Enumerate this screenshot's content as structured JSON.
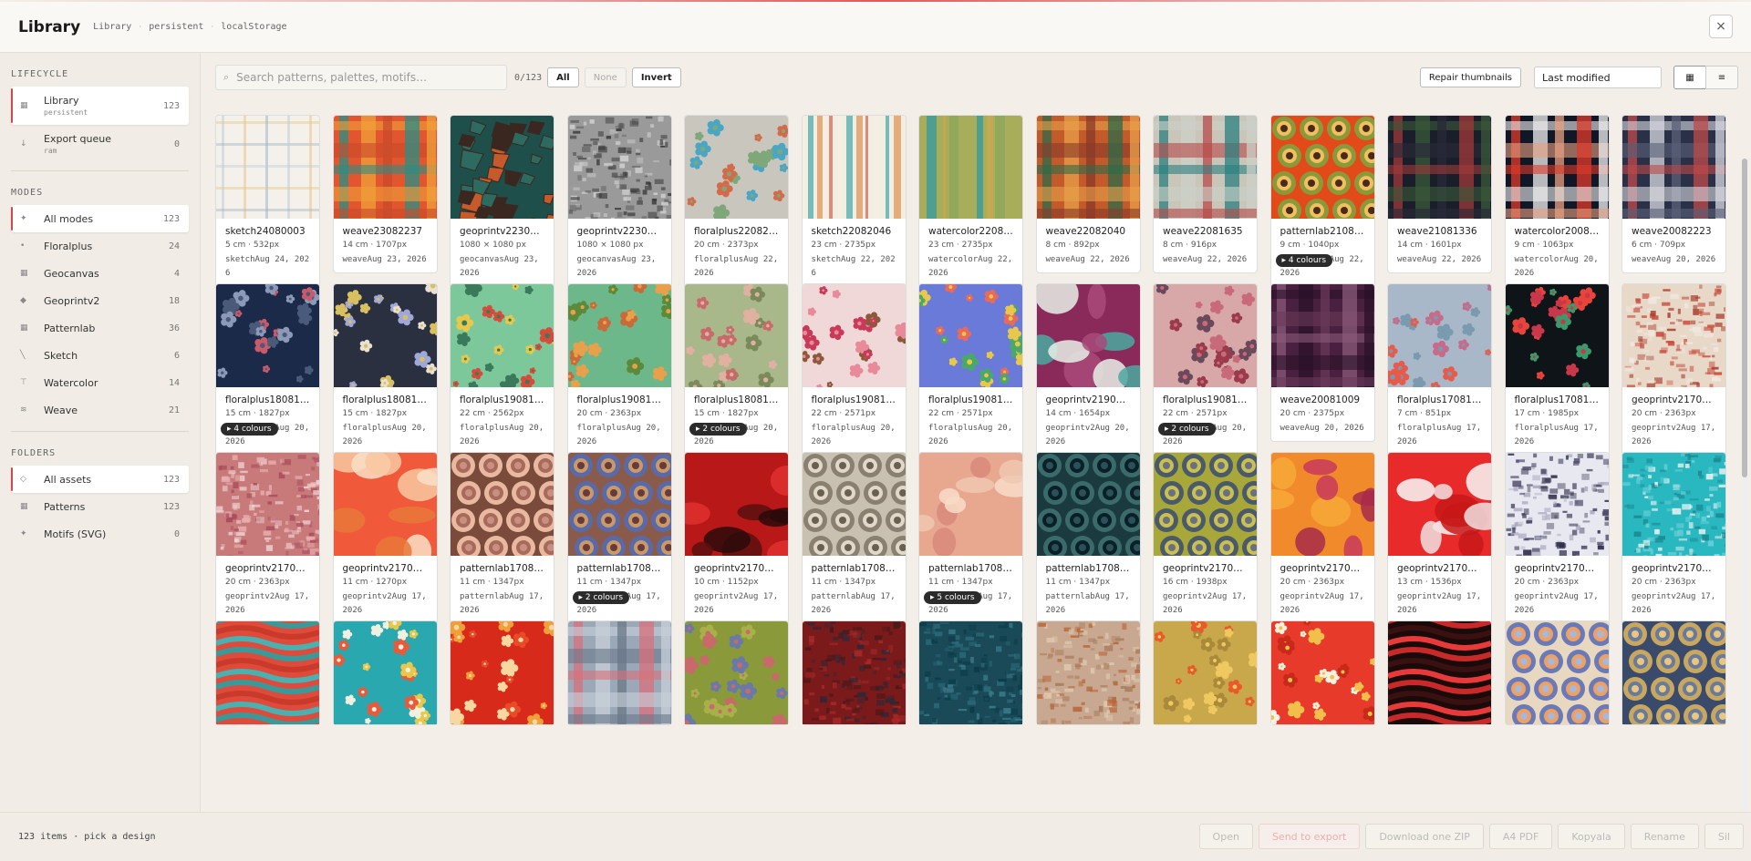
{
  "header": {
    "title": "Library",
    "crumbs": [
      "Library",
      "persistent",
      "localStorage"
    ],
    "close_label": "×"
  },
  "sidebar": {
    "lifecycle_title": "LIFECYCLE",
    "lifecycle": [
      {
        "label": "Library",
        "sub": "persistent",
        "count": "123",
        "icon": "▦",
        "active": true
      },
      {
        "label": "Export queue",
        "sub": "ram",
        "count": "0",
        "icon": "↓",
        "active": false
      }
    ],
    "modes_title": "MODES",
    "modes": [
      {
        "label": "All modes",
        "count": "123",
        "icon": "✦",
        "active": true
      },
      {
        "label": "Floralplus",
        "count": "24",
        "icon": "•",
        "active": false
      },
      {
        "label": "Geocanvas",
        "count": "4",
        "icon": "▦",
        "active": false
      },
      {
        "label": "Geoprintv2",
        "count": "18",
        "icon": "◆",
        "active": false
      },
      {
        "label": "Patternlab",
        "count": "36",
        "icon": "▦",
        "active": false
      },
      {
        "label": "Sketch",
        "count": "6",
        "icon": "╲",
        "active": false
      },
      {
        "label": "Watercolor",
        "count": "14",
        "icon": "⊤",
        "active": false
      },
      {
        "label": "Weave",
        "count": "21",
        "icon": "≋",
        "active": false
      }
    ],
    "folders_title": "FOLDERS",
    "folders": [
      {
        "label": "All assets",
        "count": "123",
        "icon": "◇",
        "active": true
      },
      {
        "label": "Patterns",
        "count": "123",
        "icon": "▦",
        "active": false
      },
      {
        "label": "Motifs (SVG)",
        "count": "0",
        "icon": "✦",
        "active": false
      }
    ]
  },
  "toolbar": {
    "search_placeholder": "Search patterns, palettes, motifs…",
    "selection_count": "0/123",
    "all_label": "All",
    "none_label": "None",
    "invert_label": "Invert",
    "repair_label": "Repair thumbnails",
    "sort_value": "Last modified",
    "view_grid_icon": "▦",
    "view_list_icon": "≡"
  },
  "cards": [
    {
      "name": "sketch24080003",
      "size": "5 cm · 532px",
      "mode": "sketch",
      "date": "Aug 24, 2026",
      "badge": "",
      "pattern": "sketch",
      "colors": [
        "#f4f1ea",
        "#bcd0dc",
        "#e7c58a",
        "#9fb7c8"
      ]
    },
    {
      "name": "weave23082237",
      "size": "14 cm · 1707px",
      "mode": "weave",
      "date": "Aug 23, 2026",
      "badge": "",
      "pattern": "plaid",
      "colors": [
        "#e2562f",
        "#2a8f86",
        "#f0a03a",
        "#c94b2c"
      ]
    },
    {
      "name": "geoprintv223082…",
      "size": "1080 × 1080 px",
      "mode": "geocanvas",
      "date": "Aug 23, 2026",
      "badge": "",
      "pattern": "mosaic",
      "colors": [
        "#1e4f4a",
        "#c75a2a",
        "#3a2820",
        "#2d6a5f"
      ]
    },
    {
      "name": "geoprintv223082…",
      "size": "1080 × 1080 px",
      "mode": "geocanvas",
      "date": "Aug 23, 2026",
      "badge": "",
      "pattern": "noise",
      "colors": [
        "#9a9a9a",
        "#555555",
        "#cfcfcf",
        "#3a3a3a"
      ]
    },
    {
      "name": "floralplus22082054",
      "size": "20 cm · 2373px",
      "mode": "floralplus",
      "date": "Aug 22, 2026",
      "badge": "",
      "pattern": "floral",
      "colors": [
        "#c9c7bd",
        "#4aa6c4",
        "#d36b4a",
        "#7fa87a"
      ]
    },
    {
      "name": "sketch22082046",
      "size": "23 cm · 2735px",
      "mode": "sketch",
      "date": "Aug 22, 2026",
      "badge": "",
      "pattern": "vstripes",
      "colors": [
        "#f3eee2",
        "#5fb3b0",
        "#e0a06a",
        "#d57a6a"
      ]
    },
    {
      "name": "watercolor22082…",
      "size": "23 cm · 2735px",
      "mode": "watercolor",
      "date": "Aug 22, 2026",
      "badge": "",
      "pattern": "vstripes",
      "colors": [
        "#a8ad5c",
        "#3e9c98",
        "#c8a850",
        "#8ea85a"
      ]
    },
    {
      "name": "weave22082040",
      "size": "8 cm · 892px",
      "mode": "weave",
      "date": "Aug 22, 2026",
      "badge": "",
      "pattern": "plaid",
      "colors": [
        "#c25a2a",
        "#2b6b4a",
        "#e8a04a",
        "#8a3a2a"
      ]
    },
    {
      "name": "weave22081635",
      "size": "8 cm · 916px",
      "mode": "weave",
      "date": "Aug 22, 2026",
      "badge": "",
      "pattern": "plaid",
      "colors": [
        "#c9c5b9",
        "#2a7f80",
        "#ccd0c8",
        "#b84a4a"
      ]
    },
    {
      "name": "patternlab210813…",
      "size": "9 cm · 1040px",
      "mode": "patternlab",
      "date": "Aug 22, 2026",
      "badge": "▸ 4 colours",
      "pattern": "circles",
      "colors": [
        "#e24a1a",
        "#8a9a3a",
        "#f0c060",
        "#4a2a1a"
      ]
    },
    {
      "name": "weave21081336",
      "size": "14 cm · 1601px",
      "mode": "weave",
      "date": "Aug 22, 2026",
      "badge": "",
      "pattern": "plaid",
      "colors": [
        "#1a1e2a",
        "#a03a3a",
        "#3a5a3a",
        "#2a2a3a"
      ]
    },
    {
      "name": "watercolor20082…",
      "size": "9 cm · 1063px",
      "mode": "watercolor",
      "date": "Aug 20, 2026",
      "badge": "",
      "pattern": "plaid",
      "colors": [
        "#101828",
        "#e03a2a",
        "#f0f0f0",
        "#e8a080"
      ]
    },
    {
      "name": "weave20082223",
      "size": "6 cm · 709px",
      "mode": "weave",
      "date": "Aug 20, 2026",
      "badge": "",
      "pattern": "plaid",
      "colors": [
        "#2a3048",
        "#c04a4a",
        "#d8d8e0",
        "#5a6078"
      ]
    },
    {
      "name": "floralplus18081848",
      "size": "15 cm · 1827px",
      "mode": "floralplus",
      "date": "Aug 20, 2026",
      "badge": "▸ 4 colours",
      "pattern": "floral",
      "colors": [
        "#1b2a48",
        "#8a9ab8",
        "#c85a6a",
        "#4a5a7a"
      ]
    },
    {
      "name": "floralplus18081846",
      "size": "15 cm · 1827px",
      "mode": "floralplus",
      "date": "Aug 20, 2026",
      "badge": "",
      "pattern": "floral",
      "colors": [
        "#2a3040",
        "#a0a8d8",
        "#e8e0d0",
        "#d8c060"
      ]
    },
    {
      "name": "floralplus19081152",
      "size": "22 cm · 2562px",
      "mode": "floralplus",
      "date": "Aug 20, 2026",
      "badge": "",
      "pattern": "floral",
      "colors": [
        "#7cc89a",
        "#d84a3a",
        "#e8c84a",
        "#3a7a5a"
      ]
    },
    {
      "name": "floralplus19081147",
      "size": "20 cm · 2363px",
      "mode": "floralplus",
      "date": "Aug 20, 2026",
      "badge": "",
      "pattern": "floral",
      "colors": [
        "#6db88a",
        "#c86a3a",
        "#5a8a3a",
        "#e8a04a"
      ]
    },
    {
      "name": "floralplus18081851",
      "size": "15 cm · 1827px",
      "mode": "floralplus",
      "date": "Aug 20, 2026",
      "badge": "▸ 2 colours",
      "pattern": "floral",
      "colors": [
        "#a8b88a",
        "#c86a6a",
        "#7a8a5a",
        "#e0b0a0"
      ]
    },
    {
      "name": "floralplus19081737",
      "size": "22 cm · 2571px",
      "mode": "floralplus",
      "date": "Aug 20, 2026",
      "badge": "",
      "pattern": "floral",
      "colors": [
        "#f0d8d8",
        "#c83a5a",
        "#8a5a3a",
        "#e88a9a"
      ]
    },
    {
      "name": "floralplus19081154",
      "size": "22 cm · 2571px",
      "mode": "floralplus",
      "date": "Aug 20, 2026",
      "badge": "",
      "pattern": "floral",
      "colors": [
        "#6a7ad8",
        "#4aa86a",
        "#e86a5a",
        "#e8c84a"
      ]
    },
    {
      "name": "geoprintv219081…",
      "size": "14 cm · 1654px",
      "mode": "geoprintv2",
      "date": "Aug 20, 2026",
      "badge": "",
      "pattern": "blobs",
      "colors": [
        "#8a2a5a",
        "#e8f0e8",
        "#4aa8a0",
        "#a84a7a"
      ]
    },
    {
      "name": "floralplus19081733",
      "size": "22 cm · 2571px",
      "mode": "floralplus",
      "date": "Aug 20, 2026",
      "badge": "▸ 2 colours",
      "pattern": "floral",
      "colors": [
        "#d8a8a8",
        "#9a3a4a",
        "#6a4a5a",
        "#c86a7a"
      ]
    },
    {
      "name": "weave20081009",
      "size": "20 cm · 2375px",
      "mode": "weave",
      "date": "Aug 20, 2026",
      "badge": "",
      "pattern": "plaid",
      "colors": [
        "#4a2040",
        "#8a5a7a",
        "#2a1028",
        "#6a3a5a"
      ]
    },
    {
      "name": "floralplus17081326",
      "size": "7 cm · 851px",
      "mode": "floralplus",
      "date": "Aug 17, 2026",
      "badge": "",
      "pattern": "floral",
      "colors": [
        "#a8b8c8",
        "#e85a4a",
        "#c86a8a",
        "#7a9ab0"
      ]
    },
    {
      "name": "floralplus17081328",
      "size": "17 cm · 1985px",
      "mode": "floralplus",
      "date": "Aug 17, 2026",
      "badge": "",
      "pattern": "floral",
      "colors": [
        "#0e1418",
        "#e8443a",
        "#3a9a6a",
        "#c8384a"
      ]
    },
    {
      "name": "geoprintv217081…",
      "size": "20 cm · 2363px",
      "mode": "geoprintv2",
      "date": "Aug 17, 2026",
      "badge": "",
      "pattern": "noise",
      "colors": [
        "#e8d8c8",
        "#c84a3a",
        "#f0e8e0",
        "#a83a2a"
      ]
    },
    {
      "name": "geoprintv217081…",
      "size": "20 cm · 2363px",
      "mode": "geoprintv2",
      "date": "Aug 17, 2026",
      "badge": "",
      "pattern": "noise",
      "colors": [
        "#c87a7a",
        "#f0d8d8",
        "#a84a5a",
        "#e8b0b0"
      ]
    },
    {
      "name": "geoprintv217081…",
      "size": "11 cm · 1270px",
      "mode": "geoprintv2",
      "date": "Aug 17, 2026",
      "badge": "",
      "pattern": "blobs",
      "colors": [
        "#f05a3a",
        "#f8c8a0",
        "#e8783a",
        "#fae0c8"
      ]
    },
    {
      "name": "patternlab170813…",
      "size": "11 cm · 1347px",
      "mode": "patternlab",
      "date": "Aug 17, 2026",
      "badge": "",
      "pattern": "circles",
      "colors": [
        "#7a4a3a",
        "#e8b8a0",
        "#a86a5a",
        "#c89080"
      ]
    },
    {
      "name": "patternlab170813…",
      "size": "11 cm · 1347px",
      "mode": "patternlab",
      "date": "Aug 17, 2026",
      "badge": "▸ 2 colours",
      "pattern": "circles",
      "colors": [
        "#8a5a4a",
        "#5a6aa8",
        "#c89a6a",
        "#6a3a3a"
      ]
    },
    {
      "name": "geoprintv217081…",
      "size": "10 cm · 1152px",
      "mode": "geoprintv2",
      "date": "Aug 17, 2026",
      "badge": "",
      "pattern": "blobs",
      "colors": [
        "#b81818",
        "#2a0a0a",
        "#e03030",
        "#5a1010"
      ]
    },
    {
      "name": "patternlab170813…",
      "size": "11 cm · 1347px",
      "mode": "patternlab",
      "date": "Aug 17, 2026",
      "badge": "",
      "pattern": "circles",
      "colors": [
        "#c8c0b0",
        "#8a8070",
        "#e0d8c8",
        "#6a6050"
      ]
    },
    {
      "name": "patternlab170813…",
      "size": "11 cm · 1347px",
      "mode": "patternlab",
      "date": "Aug 17, 2026",
      "badge": "▸ 5 colours",
      "pattern": "blobs",
      "colors": [
        "#e8a890",
        "#f0c8b0",
        "#d88a7a",
        "#f8dcc8"
      ]
    },
    {
      "name": "patternlab170813…",
      "size": "11 cm · 1347px",
      "mode": "patternlab",
      "date": "Aug 17, 2026",
      "badge": "",
      "pattern": "circles",
      "colors": [
        "#1a3a40",
        "#3a6a6a",
        "#0a2028",
        "#2a5058"
      ]
    },
    {
      "name": "geoprintv217081…",
      "size": "16 cm · 1938px",
      "mode": "geoprintv2",
      "date": "Aug 17, 2026",
      "badge": "",
      "pattern": "circles",
      "colors": [
        "#a8a83a",
        "#4a5a6a",
        "#c8c050",
        "#6a7080"
      ]
    },
    {
      "name": "geoprintv217081…",
      "size": "20 cm · 2363px",
      "mode": "geoprintv2",
      "date": "Aug 17, 2026",
      "badge": "",
      "pattern": "blobs",
      "colors": [
        "#f08a2a",
        "#a82a4a",
        "#f8a83a",
        "#c83a5a"
      ]
    },
    {
      "name": "geoprintv217081…",
      "size": "13 cm · 1536px",
      "mode": "geoprintv2",
      "date": "Aug 17, 2026",
      "badge": "",
      "pattern": "blobs",
      "colors": [
        "#e82a2a",
        "#f8f8f8",
        "#c81818",
        "#f0e0e0"
      ]
    },
    {
      "name": "geoprintv217081…",
      "size": "20 cm · 2363px",
      "mode": "geoprintv2",
      "date": "Aug 17, 2026",
      "badge": "",
      "pattern": "noise",
      "colors": [
        "#e8e8f0",
        "#2a2a48",
        "#a8a8c0",
        "#4a4a68"
      ]
    },
    {
      "name": "geoprintv217081…",
      "size": "20 cm · 2363px",
      "mode": "geoprintv2",
      "date": "Aug 17, 2026",
      "badge": "",
      "pattern": "noise",
      "colors": [
        "#2ab8c0",
        "#e8f0f0",
        "#1a8890",
        "#6ad0d8"
      ]
    },
    {
      "name": "",
      "size": "",
      "mode": "",
      "date": "",
      "badge": "",
      "pattern": "waves",
      "colors": [
        "#e04a3a",
        "#3a9a9a",
        "#c83a2a",
        "#4ab0b0"
      ]
    },
    {
      "name": "",
      "size": "",
      "mode": "",
      "date": "",
      "badge": "",
      "pattern": "floral",
      "colors": [
        "#2aa8b0",
        "#e8c84a",
        "#e85a3a",
        "#f0f0e0"
      ]
    },
    {
      "name": "",
      "size": "",
      "mode": "",
      "date": "",
      "badge": "",
      "pattern": "floral",
      "colors": [
        "#d82a1a",
        "#f0a03a",
        "#e84a2a",
        "#f8d8a0"
      ]
    },
    {
      "name": "",
      "size": "",
      "mode": "",
      "date": "",
      "badge": "",
      "pattern": "plaid",
      "colors": [
        "#9aa8b8",
        "#d8707a",
        "#c8d0d8",
        "#6a7888"
      ]
    },
    {
      "name": "",
      "size": "",
      "mode": "",
      "date": "",
      "badge": "",
      "pattern": "floral",
      "colors": [
        "#8a9a3a",
        "#6a7aa8",
        "#a8b04a",
        "#c86a6a"
      ]
    },
    {
      "name": "",
      "size": "",
      "mode": "",
      "date": "",
      "badge": "",
      "pattern": "noise",
      "colors": [
        "#7a1a1a",
        "#2a2a3a",
        "#a82a2a",
        "#4a1818"
      ]
    },
    {
      "name": "",
      "size": "",
      "mode": "",
      "date": "",
      "badge": "",
      "pattern": "noise",
      "colors": [
        "#1a4a58",
        "#2a6a78",
        "#0a3a48",
        "#3a7a88"
      ]
    },
    {
      "name": "",
      "size": "",
      "mode": "",
      "date": "",
      "badge": "",
      "pattern": "noise",
      "colors": [
        "#c8a890",
        "#b8683a",
        "#e0c8b0",
        "#a87a5a"
      ]
    },
    {
      "name": "",
      "size": "",
      "mode": "",
      "date": "",
      "badge": "",
      "pattern": "floral",
      "colors": [
        "#c8a84a",
        "#e85a2a",
        "#a88a3a",
        "#f0c860"
      ]
    },
    {
      "name": "",
      "size": "",
      "mode": "",
      "date": "",
      "badge": "",
      "pattern": "floral",
      "colors": [
        "#e83a2a",
        "#f8f0e0",
        "#c82a1a",
        "#f0c04a"
      ]
    },
    {
      "name": "",
      "size": "",
      "mode": "",
      "date": "",
      "badge": "",
      "pattern": "waves",
      "colors": [
        "#1a0a0a",
        "#c82a2a",
        "#3a1010",
        "#e83a3a"
      ]
    },
    {
      "name": "",
      "size": "",
      "mode": "",
      "date": "",
      "badge": "",
      "pattern": "circles",
      "colors": [
        "#e8d8c0",
        "#6a7ab8",
        "#f0a060",
        "#a8b8d8"
      ]
    },
    {
      "name": "",
      "size": "",
      "mode": "",
      "date": "",
      "badge": "",
      "pattern": "circles",
      "colors": [
        "#3a4a6a",
        "#c8a860",
        "#6a7a9a",
        "#e8c880"
      ]
    }
  ],
  "footer": {
    "status": "123 items · pick a design",
    "open": "Open",
    "send": "Send to export",
    "zip": "Download one ZIP",
    "pdf": "A4 PDF",
    "copy": "Kopyala",
    "rename": "Rename",
    "delete": "Sil"
  }
}
